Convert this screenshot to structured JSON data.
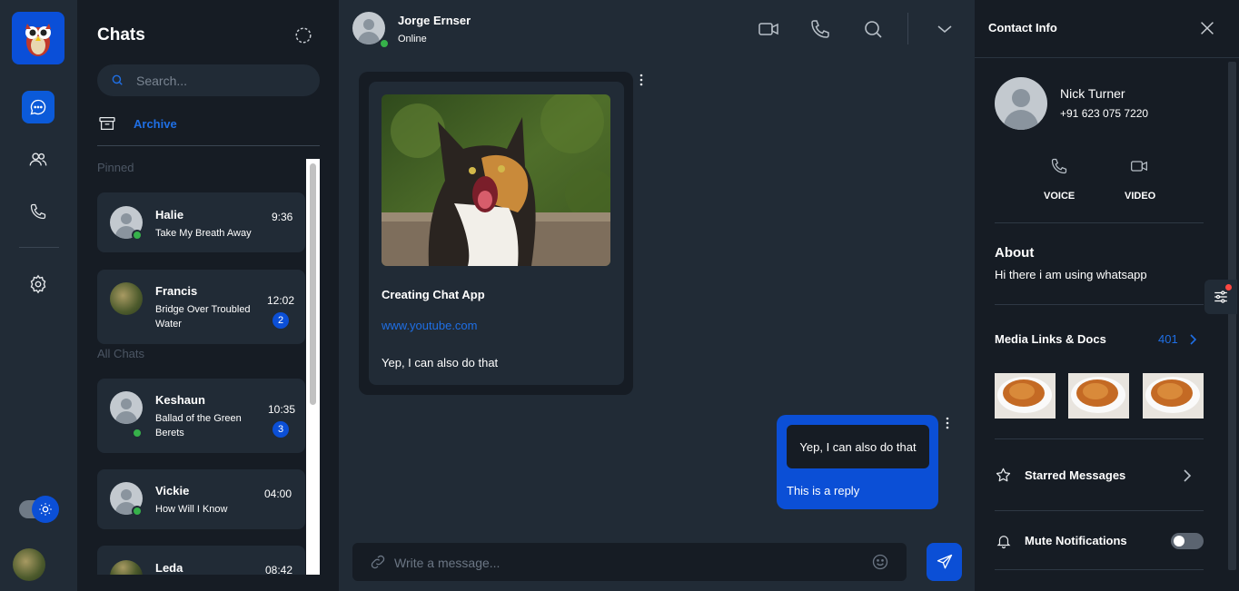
{
  "colors": {
    "accent": "#0b4fd6",
    "link": "#1f6fe5",
    "online": "#36b14a",
    "panel": "#212b36",
    "background": "#161c24"
  },
  "sidebar": {
    "items": [
      {
        "icon": "chat-bubble-icon",
        "active": true
      },
      {
        "icon": "users-icon",
        "active": false
      },
      {
        "icon": "phone-icon",
        "active": false
      },
      {
        "icon": "gear-icon",
        "active": false
      }
    ]
  },
  "chat_list": {
    "title": "Chats",
    "search_placeholder": "Search...",
    "archive_label": "Archive",
    "pinned_label": "Pinned",
    "all_label": "All Chats",
    "pinned": [
      {
        "name": "Halie",
        "message": "Take My Breath Away",
        "time": "9:36",
        "online": true
      },
      {
        "name": "Francis",
        "message": "Bridge Over Troubled Water",
        "time": "12:02",
        "unread": "2"
      }
    ],
    "all": [
      {
        "name": "Keshaun",
        "message": "Ballad of the Green Berets",
        "time": "10:35",
        "unread": "3",
        "online": true
      },
      {
        "name": "Vickie",
        "message": "How Will I Know",
        "time": "04:00",
        "online": true
      },
      {
        "name": "Leda",
        "time": "08:42"
      }
    ]
  },
  "conversation": {
    "contact_name": "Jorge Ernser",
    "contact_status": "Online",
    "incoming": {
      "link_title": "Creating Chat App",
      "link_url": "www.youtube.com",
      "text": "Yep, I can also do that"
    },
    "outgoing": {
      "quoted": "Yep, I can also do that",
      "text": "This is a reply"
    },
    "composer_placeholder": "Write a message..."
  },
  "contact_info": {
    "title": "Contact Info",
    "name": "Nick Turner",
    "phone": "+91 623 075 7220",
    "voice_label": "VOICE",
    "video_label": "VIDEO",
    "about_title": "About",
    "about_text": "Hi there i am using whatsapp",
    "media_title": "Media Links & Docs",
    "media_count": "401",
    "starred_label": "Starred Messages",
    "mute_label": "Mute Notifications",
    "mute_enabled": false
  }
}
